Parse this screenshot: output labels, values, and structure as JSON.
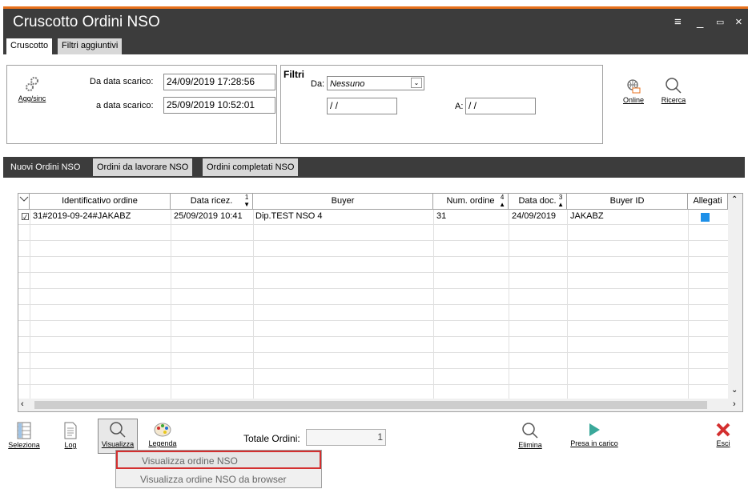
{
  "window": {
    "title": "Cruscotto Ordini NSO",
    "controls": [
      "≡",
      "_",
      "▭",
      "×"
    ]
  },
  "top_tabs": [
    "Cruscotto",
    "Filtri aggiuntivi"
  ],
  "header_panel": {
    "agg_label": "Agg/sinc",
    "da_data_label": "Da data scarico:",
    "da_data_value": "24/09/2019 17:28:56",
    "a_data_label": "a data scarico:",
    "a_data_value": "25/09/2019 10:52:01"
  },
  "filtri": {
    "title": "Filtri",
    "da_label": "Da:",
    "da_value": "Nessuno",
    "date_from": " /  /",
    "a_label": "A:",
    "date_to": " /  /"
  },
  "actions_top": {
    "online": "Online",
    "ricerca": "Ricerca"
  },
  "list_tabs": [
    "Nuovi Ordini NSO",
    "Ordini da lavorare NSO",
    "Ordini completati NSO"
  ],
  "grid": {
    "columns": [
      "Identificativo ordine",
      "Data ricez.",
      "Buyer",
      "Num. ordine",
      "Data doc.",
      "Buyer ID",
      "Allegati"
    ],
    "sort_marks": {
      "data_ricez": "1",
      "num_ordine": "4",
      "data_doc": "3"
    },
    "rows": [
      {
        "checked": true,
        "id": "31#2019-09-24#JAKABZ",
        "data_ricez": "25/09/2019 10:41",
        "buyer": "Dip.TEST NSO 4",
        "num_ordine": "31",
        "data_doc": "24/09/2019",
        "buyer_id": "JAKABZ"
      }
    ]
  },
  "bottom_bar": {
    "seleziona": "Seleziona",
    "log": "Log",
    "visualizza": "Visualizza",
    "legenda": "Legenda",
    "totale_label": "Totale Ordini:",
    "totale_value": "1",
    "elimina": "Elimina",
    "presa_in_carico": "Presa in carico",
    "esci": "Esci"
  },
  "context_menu": {
    "items": [
      "Visualizza ordine NSO",
      "Visualizza ordine NSO da browser"
    ]
  },
  "colors": {
    "titlebar": "#3c3c3c",
    "accent": "#e8711c",
    "highlight_border": "#d32f2f",
    "allegati_square": "#1e90e8",
    "esci_red": "#d32f2f",
    "presa_green": "#3aa89a"
  }
}
